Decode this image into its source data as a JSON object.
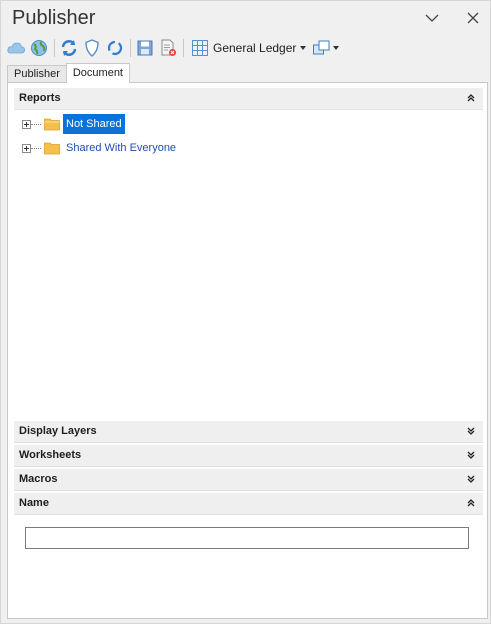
{
  "window": {
    "title": "Publisher"
  },
  "toolbar": {
    "ledger_label": "General Ledger"
  },
  "tabs": [
    {
      "label": "Publisher",
      "active": false
    },
    {
      "label": "Document",
      "active": true
    }
  ],
  "sections": {
    "reports": {
      "title": "Reports",
      "expanded": true
    },
    "display_layers": {
      "title": "Display Layers",
      "expanded": false
    },
    "worksheets": {
      "title": "Worksheets",
      "expanded": false
    },
    "macros": {
      "title": "Macros",
      "expanded": false
    },
    "name": {
      "title": "Name",
      "expanded": true
    }
  },
  "tree": [
    {
      "label": "Not Shared",
      "selected": true
    },
    {
      "label": "Shared With Everyone",
      "selected": false
    }
  ],
  "name_field": {
    "value": ""
  },
  "colors": {
    "selection": "#0a72d8",
    "link_text": "#1f4fb0",
    "folder": "#f4c04c"
  },
  "icons": [
    "cloud-icon",
    "globe-icon",
    "refresh-icon",
    "shield-icon",
    "sync-icon",
    "save-icon",
    "delete-document-icon",
    "grid-icon",
    "window-dropdown-icon",
    "chevron-down-icon",
    "close-icon",
    "collapse-icon",
    "expand-icon",
    "folder-icon"
  ]
}
